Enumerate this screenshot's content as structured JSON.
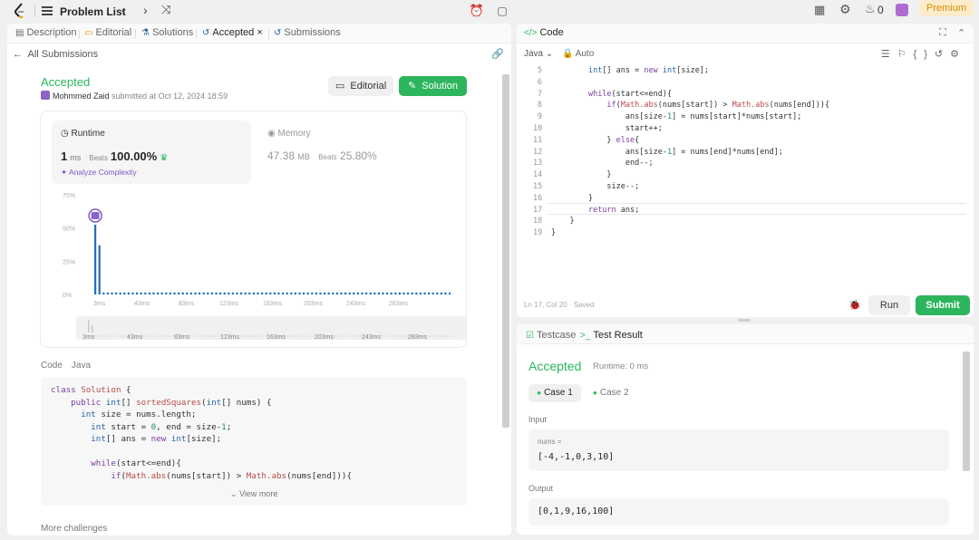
{
  "topbar": {
    "problem_list": "Problem List",
    "streak": "0",
    "premium": "Premium"
  },
  "left_tabs": [
    {
      "icon": "▤",
      "label": "Description"
    },
    {
      "icon": "▭",
      "label": "Editorial"
    },
    {
      "icon": "⚗",
      "label": "Solutions"
    },
    {
      "icon": "↺",
      "label": "Accepted",
      "close": "×"
    },
    {
      "icon": "↺",
      "label": "Submissions"
    }
  ],
  "back_label": "All Submissions",
  "submission": {
    "status": "Accepted",
    "user": "Mohmmed Zaid",
    "submitted_text": "submitted at Oct 12, 2024 18:59",
    "editorial_label": "Editorial",
    "solution_label": "Solution"
  },
  "runtime": {
    "label": "Runtime",
    "value": "1",
    "unit": "ms",
    "beats_label": "Beats",
    "beats": "100.00%",
    "analyze": "Analyze Complexity"
  },
  "memory": {
    "label": "Memory",
    "value": "47.38",
    "unit": "MB",
    "beats_label": "Beats",
    "beats": "25.80%"
  },
  "chart_data": {
    "type": "bar",
    "y_ticks": [
      "75%",
      "50%",
      "25%",
      "0%"
    ],
    "ylim": [
      0,
      75
    ],
    "x_ticks": [
      "3ms",
      "43ms",
      "83ms",
      "123ms",
      "163ms",
      "203ms",
      "243ms",
      "283ms"
    ],
    "brush_ticks": [
      "3ms",
      "43ms",
      "83ms",
      "123ms",
      "163ms",
      "203ms",
      "243ms",
      "283ms"
    ],
    "bars": [
      {
        "x": 1,
        "value": 52.5
      },
      {
        "x": 2,
        "value": 37
      }
    ],
    "baseline_value": 1.5,
    "highlight_x": 1
  },
  "code_section": {
    "label": "Code",
    "language": "Java",
    "view_more": "View more",
    "lines": [
      "class Solution {",
      "    public int[] sortedSquares(int[] nums) {",
      "      int size = nums.length;",
      "        int start = 0, end = size-1;",
      "        int[] ans = new int[size];",
      "",
      "        while(start<=end){",
      "            if(Math.abs(nums[start]) > Math.abs(nums[end])){"
    ]
  },
  "more_challenges": "More challenges",
  "code_panel": {
    "title": "Code",
    "language": "Java",
    "auto": "Auto",
    "line_numbers": [
      "5",
      "6",
      "7",
      "8",
      "9",
      "10",
      "11",
      "12",
      "13",
      "14",
      "15",
      "16",
      "17",
      "18",
      "19"
    ],
    "lines": [
      "        int[] ans = new int[size];",
      "",
      "        while(start<=end){",
      "            if(Math.abs(nums[start]) > Math.abs(nums[end])){",
      "                ans[size-1] = nums[start]*nums[start];",
      "                start++;",
      "            } else{",
      "                ans[size-1] = nums[end]*nums[end];",
      "                end--;",
      "            }",
      "            size--;",
      "        }",
      "        return ans;",
      "    }",
      "}"
    ],
    "status": "Ln 17, Col 20  ·  Saved",
    "run_label": "Run",
    "submit_label": "Submit"
  },
  "test_panel": {
    "testcase_tab": "Testcase",
    "result_tab": "Test Result",
    "status": "Accepted",
    "runtime": "Runtime: 0 ms",
    "case1": "Case 1",
    "case2": "Case 2",
    "input_label": "Input",
    "param_name": "nums =",
    "param_value": "[-4,-1,0,3,10]",
    "output_label": "Output",
    "output_value": "[0,1,9,16,100]"
  },
  "colors": {
    "accent_green": "#2db55d",
    "bar_blue": "#1f6fbf",
    "premium_bg": "#fdeccc"
  }
}
